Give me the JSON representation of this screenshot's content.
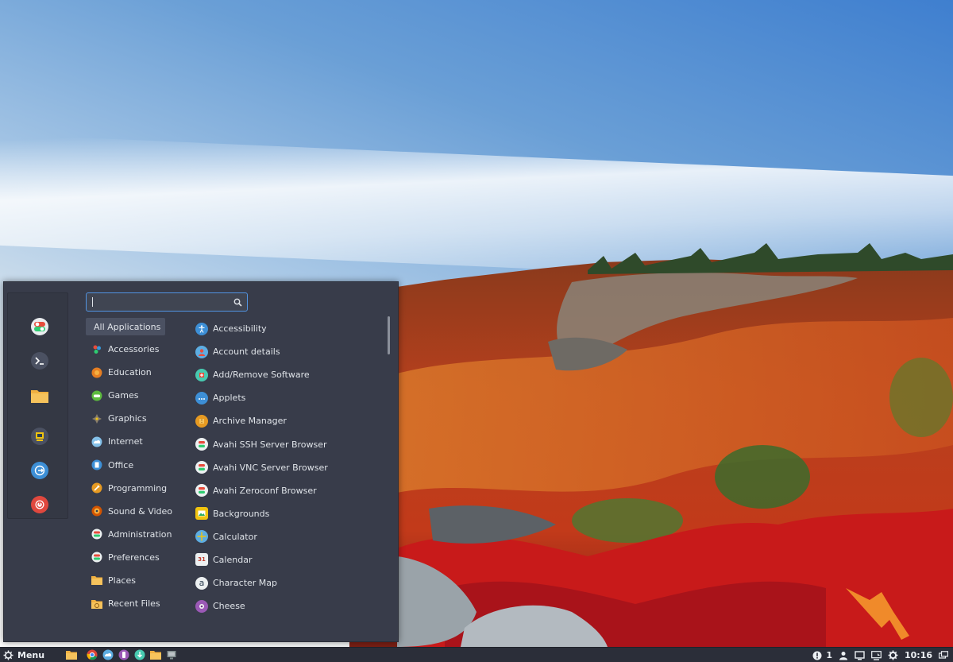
{
  "colors": {
    "menu_bg": "#383c4a",
    "selected_bg": "#4b5162",
    "accent": "#5294e2",
    "panel_bg": "#2b2e39"
  },
  "favorites": [
    {
      "name": "settings-toggle-icon"
    },
    {
      "name": "terminal-icon"
    },
    {
      "name": "folder-icon"
    },
    {
      "name": "lock-screen-icon"
    },
    {
      "name": "logout-icon"
    },
    {
      "name": "power-icon"
    }
  ],
  "search": {
    "value": "",
    "placeholder": ""
  },
  "categories": [
    {
      "label": "All Applications",
      "icon": "none"
    },
    {
      "label": "Accessories",
      "icon": "accessories-icon"
    },
    {
      "label": "Education",
      "icon": "education-icon"
    },
    {
      "label": "Games",
      "icon": "games-icon"
    },
    {
      "label": "Graphics",
      "icon": "graphics-icon"
    },
    {
      "label": "Internet",
      "icon": "internet-icon"
    },
    {
      "label": "Office",
      "icon": "office-icon"
    },
    {
      "label": "Programming",
      "icon": "programming-icon"
    },
    {
      "label": "Sound & Video",
      "icon": "sound-video-icon"
    },
    {
      "label": "Administration",
      "icon": "administration-icon"
    },
    {
      "label": "Preferences",
      "icon": "preferences-icon"
    },
    {
      "label": "Places",
      "icon": "places-folder-icon"
    },
    {
      "label": "Recent Files",
      "icon": "recent-files-icon"
    }
  ],
  "apps": [
    {
      "label": "Accessibility",
      "icon": "accessibility-icon"
    },
    {
      "label": "Account details",
      "icon": "account-details-icon"
    },
    {
      "label": "Add/Remove Software",
      "icon": "software-icon"
    },
    {
      "label": "Applets",
      "icon": "applets-icon"
    },
    {
      "label": "Archive Manager",
      "icon": "archive-icon"
    },
    {
      "label": "Avahi SSH Server Browser",
      "icon": "avahi-ssh-icon"
    },
    {
      "label": "Avahi VNC Server Browser",
      "icon": "avahi-vnc-icon"
    },
    {
      "label": "Avahi Zeroconf Browser",
      "icon": "avahi-zeroconf-icon"
    },
    {
      "label": "Backgrounds",
      "icon": "backgrounds-icon"
    },
    {
      "label": "Calculator",
      "icon": "calculator-icon"
    },
    {
      "label": "Calendar",
      "icon": "calendar-icon"
    },
    {
      "label": "Character Map",
      "icon": "character-map-icon"
    },
    {
      "label": "Cheese",
      "icon": "cheese-icon"
    }
  ],
  "icon_glyphs": {
    "calendar": "31",
    "character_map": "a"
  },
  "panel": {
    "menu_label": "Menu",
    "launchers": [
      "show-desktop-icon",
      "chrome-icon",
      "fedora-browser-icon",
      "purple-app-icon",
      "teal-app-icon",
      "files-icon",
      "workspace-icon"
    ],
    "notification_count": "1",
    "clock": "10:16"
  }
}
